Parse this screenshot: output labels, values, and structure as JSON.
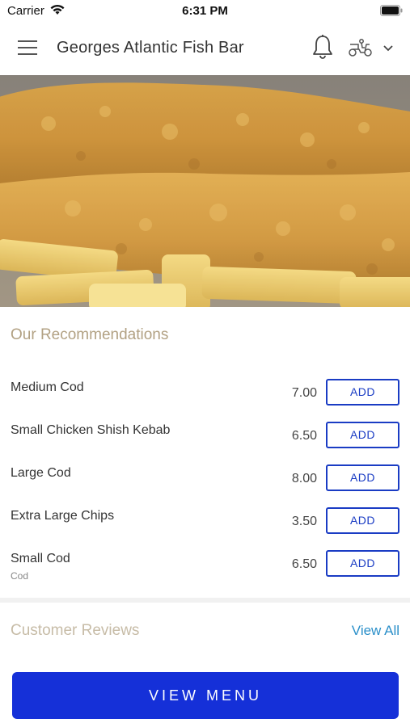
{
  "status_bar": {
    "carrier": "Carrier",
    "time": "6:31 PM"
  },
  "header": {
    "title": "Georges Atlantic Fish Bar"
  },
  "recommendations": {
    "title": "Our Recommendations",
    "add_label": "ADD",
    "items": [
      {
        "name": "Medium Cod",
        "subtitle": "",
        "price": "7.00"
      },
      {
        "name": "Small Chicken Shish Kebab",
        "subtitle": "",
        "price": "6.50"
      },
      {
        "name": "Large Cod",
        "subtitle": "",
        "price": "8.00"
      },
      {
        "name": "Extra Large Chips",
        "subtitle": "",
        "price": "3.50"
      },
      {
        "name": "Small Cod",
        "subtitle": "Cod",
        "price": "6.50"
      }
    ]
  },
  "reviews": {
    "title": "Customer Reviews",
    "view_all": "View All"
  },
  "footer": {
    "view_menu": "VIEW MENU"
  },
  "colors": {
    "accent_blue": "#1530d8",
    "section_title": "#b2a183",
    "link": "#2a8fc9"
  }
}
